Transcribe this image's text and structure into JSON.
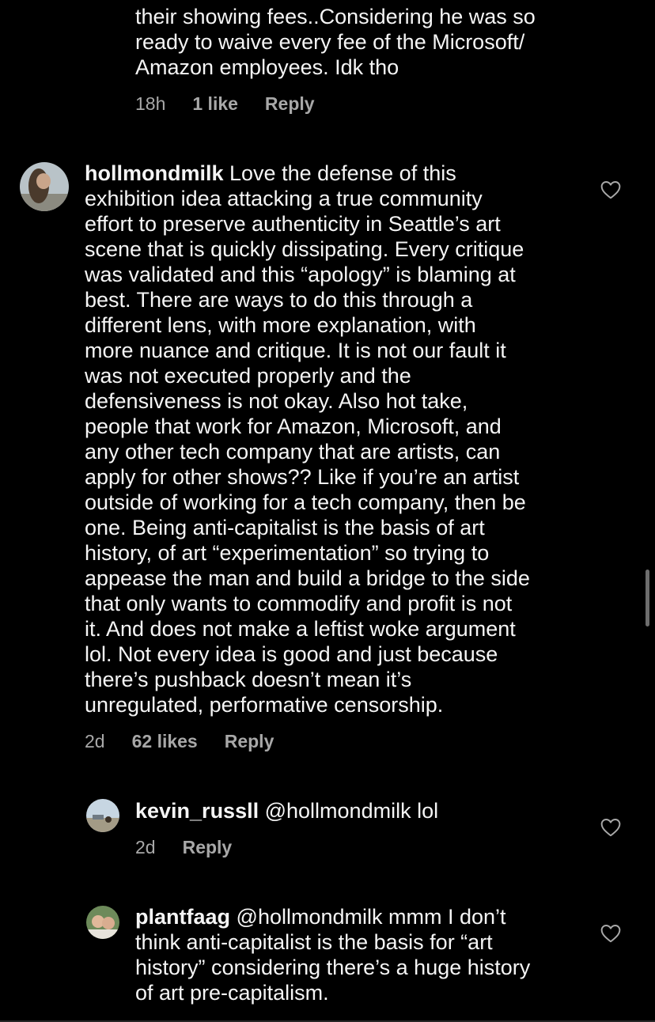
{
  "top_comment": {
    "text": "their showing fees..Considering he was so\nready to waive every fee of the Microsoft/\nAmazon employees. Idk tho",
    "time": "18h",
    "likes": "1 like",
    "reply": "Reply"
  },
  "main_comment": {
    "username": "hollmondmilk",
    "text": "Love the defense of this\nexhibition idea attacking a true community\neffort to preserve authenticity in Seattle’s art\nscene that is quickly dissipating. Every critique\nwas validated and this “apology” is blaming at\nbest. There are ways to do this through a\ndifferent lens, with more explanation, with\nmore nuance and critique. It is not our fault it\nwas not executed properly and the\ndefensiveness is not okay. Also hot take,\npeople that work for Amazon, Microsoft, and\nany other tech company that are artists, can\napply for other shows?? Like if you’re an artist\noutside of working for a tech company, then be\none. Being anti-capitalist is the basis of art\nhistory, of art “experimentation” so trying to\nappease the man and build a bridge to the side\nthat only wants to commodify and profit is not\nit. And does not make a leftist woke argument\nlol. Not every idea is good and just because\nthere’s pushback doesn’t mean it’s\nunregulated, performative censorship.",
    "time": "2d",
    "likes": "62 likes",
    "reply": "Reply"
  },
  "reply_1": {
    "username": "kevin_russll",
    "text": "@hollmondmilk lol",
    "time": "2d",
    "reply": "Reply"
  },
  "reply_2": {
    "username": "plantfaag",
    "text": "@hollmondmilk mmm I don’t\nthink anti-capitalist is the basis for “art\nhistory” considering there’s a huge history\nof art pre-capitalism."
  },
  "colors": {
    "background": "#000000",
    "text": "#f5f5f5",
    "meta": "#a8a8a8"
  },
  "icons": {
    "like": "heart-outline-icon"
  }
}
